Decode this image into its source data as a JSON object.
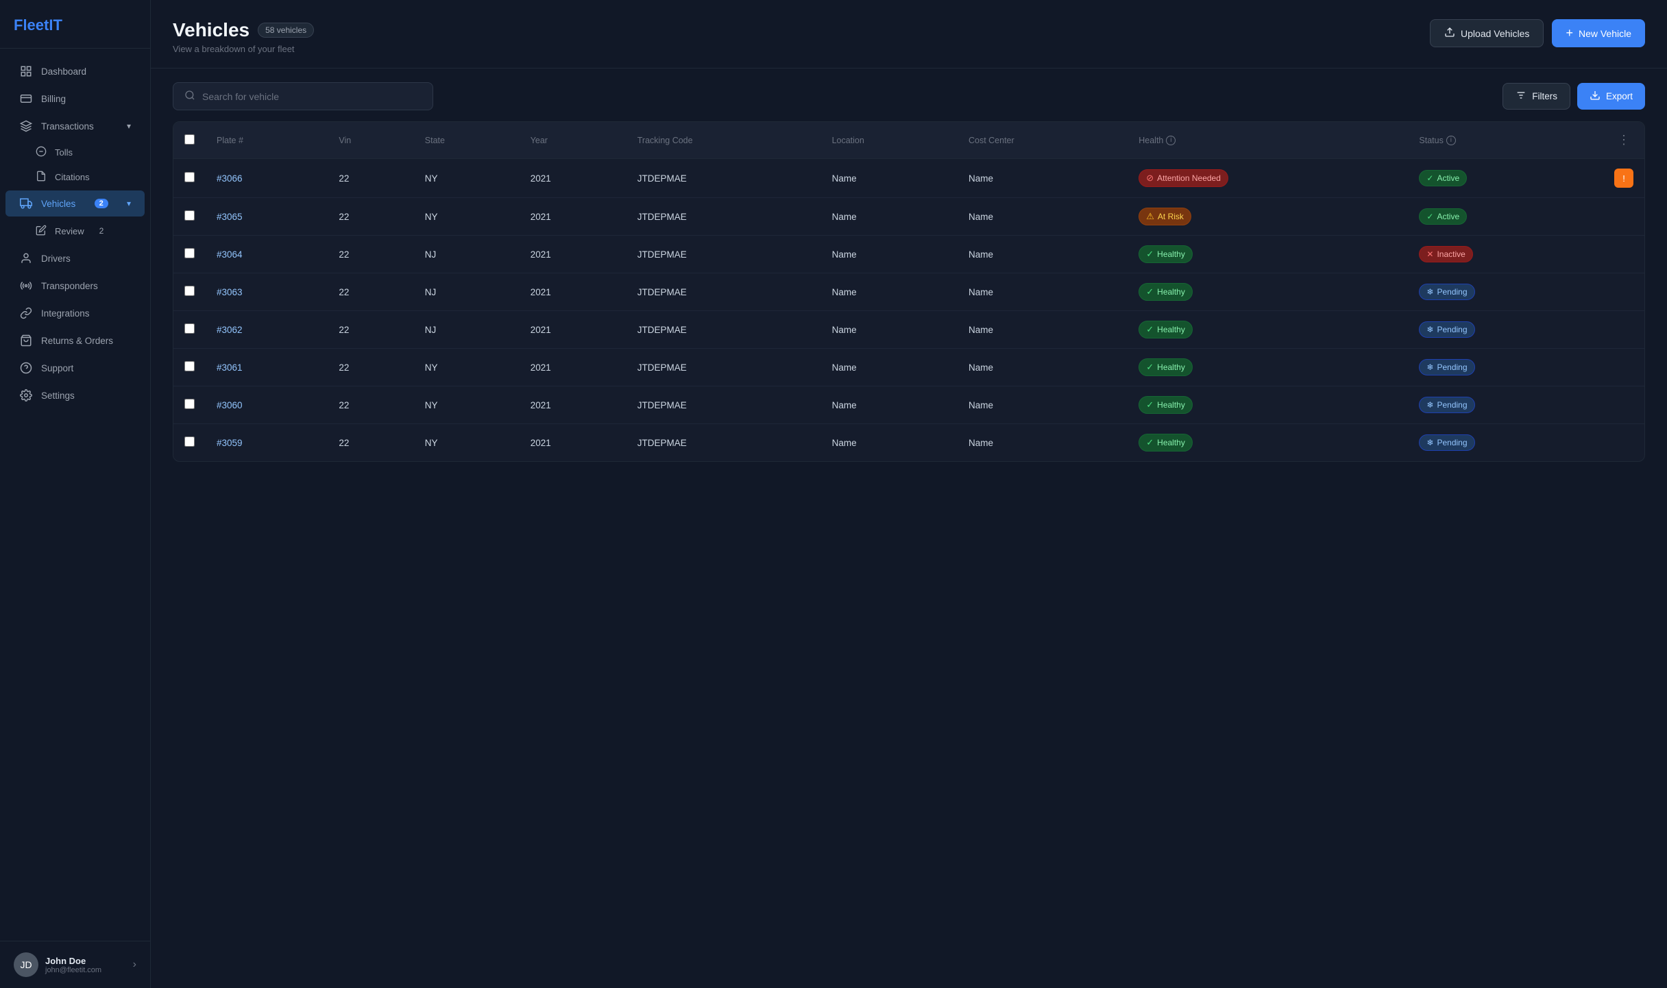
{
  "sidebar": {
    "logo": {
      "fleet": "Fleet",
      "it": "IT"
    },
    "nav": [
      {
        "id": "dashboard",
        "label": "Dashboard",
        "icon": "grid",
        "active": false
      },
      {
        "id": "billing",
        "label": "Billing",
        "icon": "billing",
        "active": false
      },
      {
        "id": "transactions",
        "label": "Transactions",
        "icon": "layers",
        "active": false,
        "expandable": true
      },
      {
        "id": "tolls",
        "label": "Tolls",
        "icon": "toll",
        "active": false,
        "sub": true
      },
      {
        "id": "citations",
        "label": "Citations",
        "icon": "citation",
        "active": false,
        "sub": true
      },
      {
        "id": "vehicles",
        "label": "Vehicles",
        "icon": "car",
        "active": true,
        "badge": "2",
        "expandable": true
      },
      {
        "id": "review",
        "label": "Review",
        "icon": "review",
        "active": false,
        "badge": "2",
        "sub": true
      },
      {
        "id": "drivers",
        "label": "Drivers",
        "icon": "drivers",
        "active": false
      },
      {
        "id": "transponders",
        "label": "Transponders",
        "icon": "transponders",
        "active": false
      },
      {
        "id": "integrations",
        "label": "Integrations",
        "icon": "integrations",
        "active": false
      },
      {
        "id": "returns",
        "label": "Returns & Orders",
        "icon": "returns",
        "active": false
      },
      {
        "id": "support",
        "label": "Support",
        "icon": "support",
        "active": false
      },
      {
        "id": "settings",
        "label": "Settings",
        "icon": "settings",
        "active": false
      }
    ],
    "user": {
      "name": "John Doe",
      "email": "john@fleetit.com",
      "initials": "JD"
    }
  },
  "header": {
    "title": "Vehicles",
    "count_badge": "58 vehicles",
    "subtitle": "View a breakdown of your fleet",
    "upload_btn": "Upload Vehicles",
    "new_btn": "New Vehicle"
  },
  "toolbar": {
    "search_placeholder": "Search for vehicle",
    "filters_btn": "Filters",
    "export_btn": "Export"
  },
  "table": {
    "columns": [
      {
        "id": "plate",
        "label": "Plate #"
      },
      {
        "id": "vin",
        "label": "Vin"
      },
      {
        "id": "state",
        "label": "State"
      },
      {
        "id": "year",
        "label": "Year"
      },
      {
        "id": "tracking_code",
        "label": "Tracking Code"
      },
      {
        "id": "location",
        "label": "Location"
      },
      {
        "id": "cost_center",
        "label": "Cost Center"
      },
      {
        "id": "health",
        "label": "Health",
        "info": true
      },
      {
        "id": "status",
        "label": "Status",
        "info": true
      }
    ],
    "rows": [
      {
        "id": "r1",
        "plate": "#3066",
        "vin": "22",
        "state": "NY",
        "year": "2021",
        "tracking_code": "JTDEPMAE",
        "location": "Name",
        "cost_center": "Name",
        "health": "Attention Needed",
        "health_type": "attention",
        "status": "Active",
        "status_type": "active",
        "has_action": true
      },
      {
        "id": "r2",
        "plate": "#3065",
        "vin": "22",
        "state": "NY",
        "year": "2021",
        "tracking_code": "JTDEPMAE",
        "location": "Name",
        "cost_center": "Name",
        "health": "At Risk",
        "health_type": "atrisk",
        "status": "Active",
        "status_type": "active",
        "has_action": false
      },
      {
        "id": "r3",
        "plate": "#3064",
        "vin": "22",
        "state": "NJ",
        "year": "2021",
        "tracking_code": "JTDEPMAE",
        "location": "Name",
        "cost_center": "Name",
        "health": "Healthy",
        "health_type": "healthy",
        "status": "Inactive",
        "status_type": "inactive",
        "has_action": false
      },
      {
        "id": "r4",
        "plate": "#3063",
        "vin": "22",
        "state": "NJ",
        "year": "2021",
        "tracking_code": "JTDEPMAE",
        "location": "Name",
        "cost_center": "Name",
        "health": "Healthy",
        "health_type": "healthy",
        "status": "Pending",
        "status_type": "pending",
        "has_action": false
      },
      {
        "id": "r5",
        "plate": "#3062",
        "vin": "22",
        "state": "NJ",
        "year": "2021",
        "tracking_code": "JTDEPMAE",
        "location": "Name",
        "cost_center": "Name",
        "health": "Healthy",
        "health_type": "healthy",
        "status": "Pending",
        "status_type": "pending",
        "has_action": false
      },
      {
        "id": "r6",
        "plate": "#3061",
        "vin": "22",
        "state": "NY",
        "year": "2021",
        "tracking_code": "JTDEPMAE",
        "location": "Name",
        "cost_center": "Name",
        "health": "Healthy",
        "health_type": "healthy",
        "status": "Pending",
        "status_type": "pending",
        "has_action": false
      },
      {
        "id": "r7",
        "plate": "#3060",
        "vin": "22",
        "state": "NY",
        "year": "2021",
        "tracking_code": "JTDEPMAE",
        "location": "Name",
        "cost_center": "Name",
        "health": "Healthy",
        "health_type": "healthy",
        "status": "Pending",
        "status_type": "pending",
        "has_action": false
      },
      {
        "id": "r8",
        "plate": "#3059",
        "vin": "22",
        "state": "NY",
        "year": "2021",
        "tracking_code": "JTDEPMAE",
        "location": "Name",
        "cost_center": "Name",
        "health": "Healthy",
        "health_type": "healthy",
        "status": "Pending",
        "status_type": "pending",
        "has_action": false
      }
    ]
  },
  "icons": {
    "search": "🔍",
    "upload": "⬆",
    "plus": "+",
    "filter": "≡",
    "download": "⬇",
    "info": "i",
    "warning": "⚠",
    "check": "✓",
    "x": "✕",
    "snowflake": "❄",
    "exclamation": "!"
  }
}
